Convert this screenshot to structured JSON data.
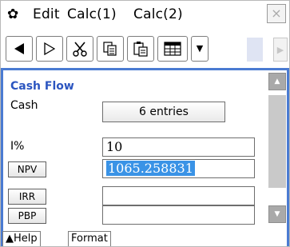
{
  "menubar": {
    "gear_icon": "gear-icon",
    "items": [
      "Edit",
      "Calc(1)",
      "Calc(2)"
    ],
    "close_label": "×"
  },
  "toolbar": {
    "buttons": [
      {
        "name": "back-arrow-button",
        "icon": "left-triangle-icon"
      },
      {
        "name": "forward-arrow-button",
        "icon": "right-triangle-outline-icon"
      },
      {
        "name": "cut-button",
        "icon": "scissors-icon"
      },
      {
        "name": "copy-button",
        "icon": "copy-icon"
      },
      {
        "name": "paste-button",
        "icon": "paste-icon"
      },
      {
        "name": "grid-button",
        "icon": "grid-icon"
      }
    ],
    "dropdown_glyph": "▼",
    "scroll_glyph": "▶"
  },
  "panel": {
    "title": "Cash Flow",
    "cash_label": "Cash",
    "cash_entries": "6 entries",
    "rate_label": "I%",
    "rate_value": "10",
    "npv_label": "NPV",
    "npv_value": "1065.258831",
    "irr_label": "IRR",
    "irr_value": "",
    "pbp_label": "PBP",
    "pbp_value": ""
  },
  "tabs": {
    "help": "▲Help",
    "format": "Format"
  },
  "colors": {
    "accent_blue": "#4a7bd2",
    "title_blue": "#2b55c0",
    "selection": "#3a93e6"
  }
}
